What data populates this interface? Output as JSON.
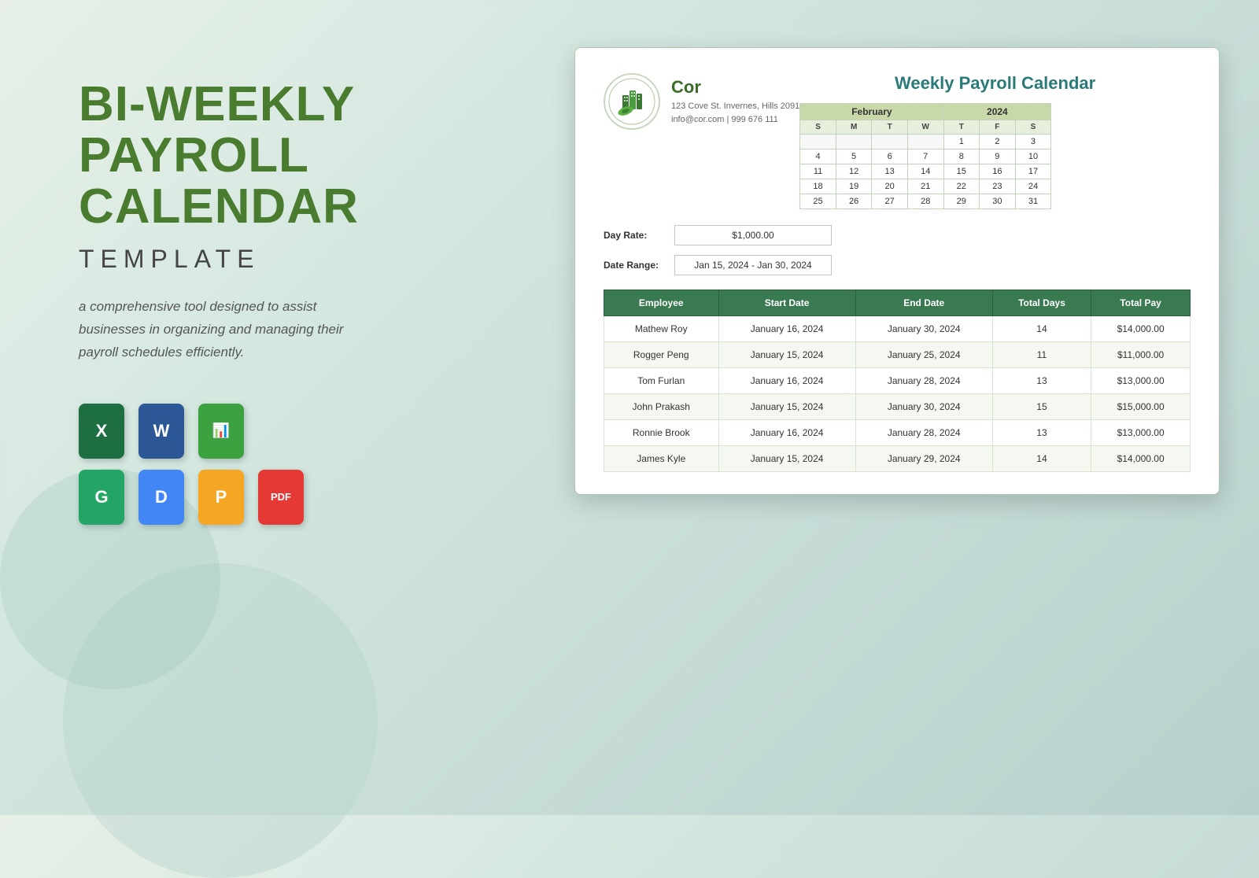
{
  "left": {
    "title_line1": "BI-WEEKLY",
    "title_line2": "PAYROLL",
    "title_line3": "CALENDAR",
    "subtitle": "TEMPLATE",
    "description": "a comprehensive tool designed to assist businesses in organizing and managing their payroll schedules efficiently.",
    "formats": [
      {
        "label": "X",
        "type": "excel",
        "class": "fi-excel"
      },
      {
        "label": "W",
        "type": "word",
        "class": "fi-word"
      },
      {
        "label": "N",
        "type": "numbers",
        "class": "fi-numbers"
      },
      {
        "label": "G",
        "type": "gsheets",
        "class": "fi-gsheets"
      },
      {
        "label": "D",
        "type": "gdocs",
        "class": "fi-gdocs"
      },
      {
        "label": "P",
        "type": "pages",
        "class": "fi-pages"
      },
      {
        "label": "PDF",
        "type": "pdf",
        "class": "fi-pdf"
      }
    ]
  },
  "document": {
    "company_name": "Cor",
    "company_address": "123 Cove St. Invernes, Hills 2091",
    "company_contact": "info@cor.com | 999 676 111",
    "calendar_title": "Weekly Payroll Calendar",
    "day_rate_label": "Day Rate:",
    "day_rate_value": "$1,000.00",
    "date_range_label": "Date Range:",
    "date_range_value": "Jan 15, 2024 - Jan 30, 2024",
    "calendar": {
      "month": "February",
      "year": "2024",
      "day_headers": [
        "S",
        "M",
        "T",
        "W",
        "T",
        "F",
        "S"
      ],
      "weeks": [
        [
          "",
          "",
          "",
          "",
          "1",
          "2",
          "3"
        ],
        [
          "4",
          "5",
          "6",
          "7",
          "8",
          "9",
          "10"
        ],
        [
          "11",
          "12",
          "13",
          "14",
          "15",
          "16",
          "17"
        ],
        [
          "18",
          "19",
          "20",
          "21",
          "22",
          "23",
          "24"
        ],
        [
          "25",
          "26",
          "27",
          "28",
          "29",
          "30",
          "31"
        ]
      ]
    },
    "table_headers": [
      "Employee",
      "Start Date",
      "End Date",
      "Total Days",
      "Total Pay"
    ],
    "employees": [
      {
        "name": "Mathew Roy",
        "start": "January 16, 2024",
        "end": "January 30, 2024",
        "days": "14",
        "pay": "$14,000.00"
      },
      {
        "name": "Rogger Peng",
        "start": "January 15, 2024",
        "end": "January 25, 2024",
        "days": "11",
        "pay": "$11,000.00"
      },
      {
        "name": "Tom Furlan",
        "start": "January 16, 2024",
        "end": "January 28, 2024",
        "days": "13",
        "pay": "$13,000.00"
      },
      {
        "name": "John Prakash",
        "start": "January 15, 2024",
        "end": "January 30, 2024",
        "days": "15",
        "pay": "$15,000.00"
      },
      {
        "name": "Ronnie Brook",
        "start": "January 16, 2024",
        "end": "January 28, 2024",
        "days": "13",
        "pay": "$13,000.00"
      },
      {
        "name": "James Kyle",
        "start": "January 15, 2024",
        "end": "January 29, 2024",
        "days": "14",
        "pay": "$14,000.00"
      }
    ]
  }
}
